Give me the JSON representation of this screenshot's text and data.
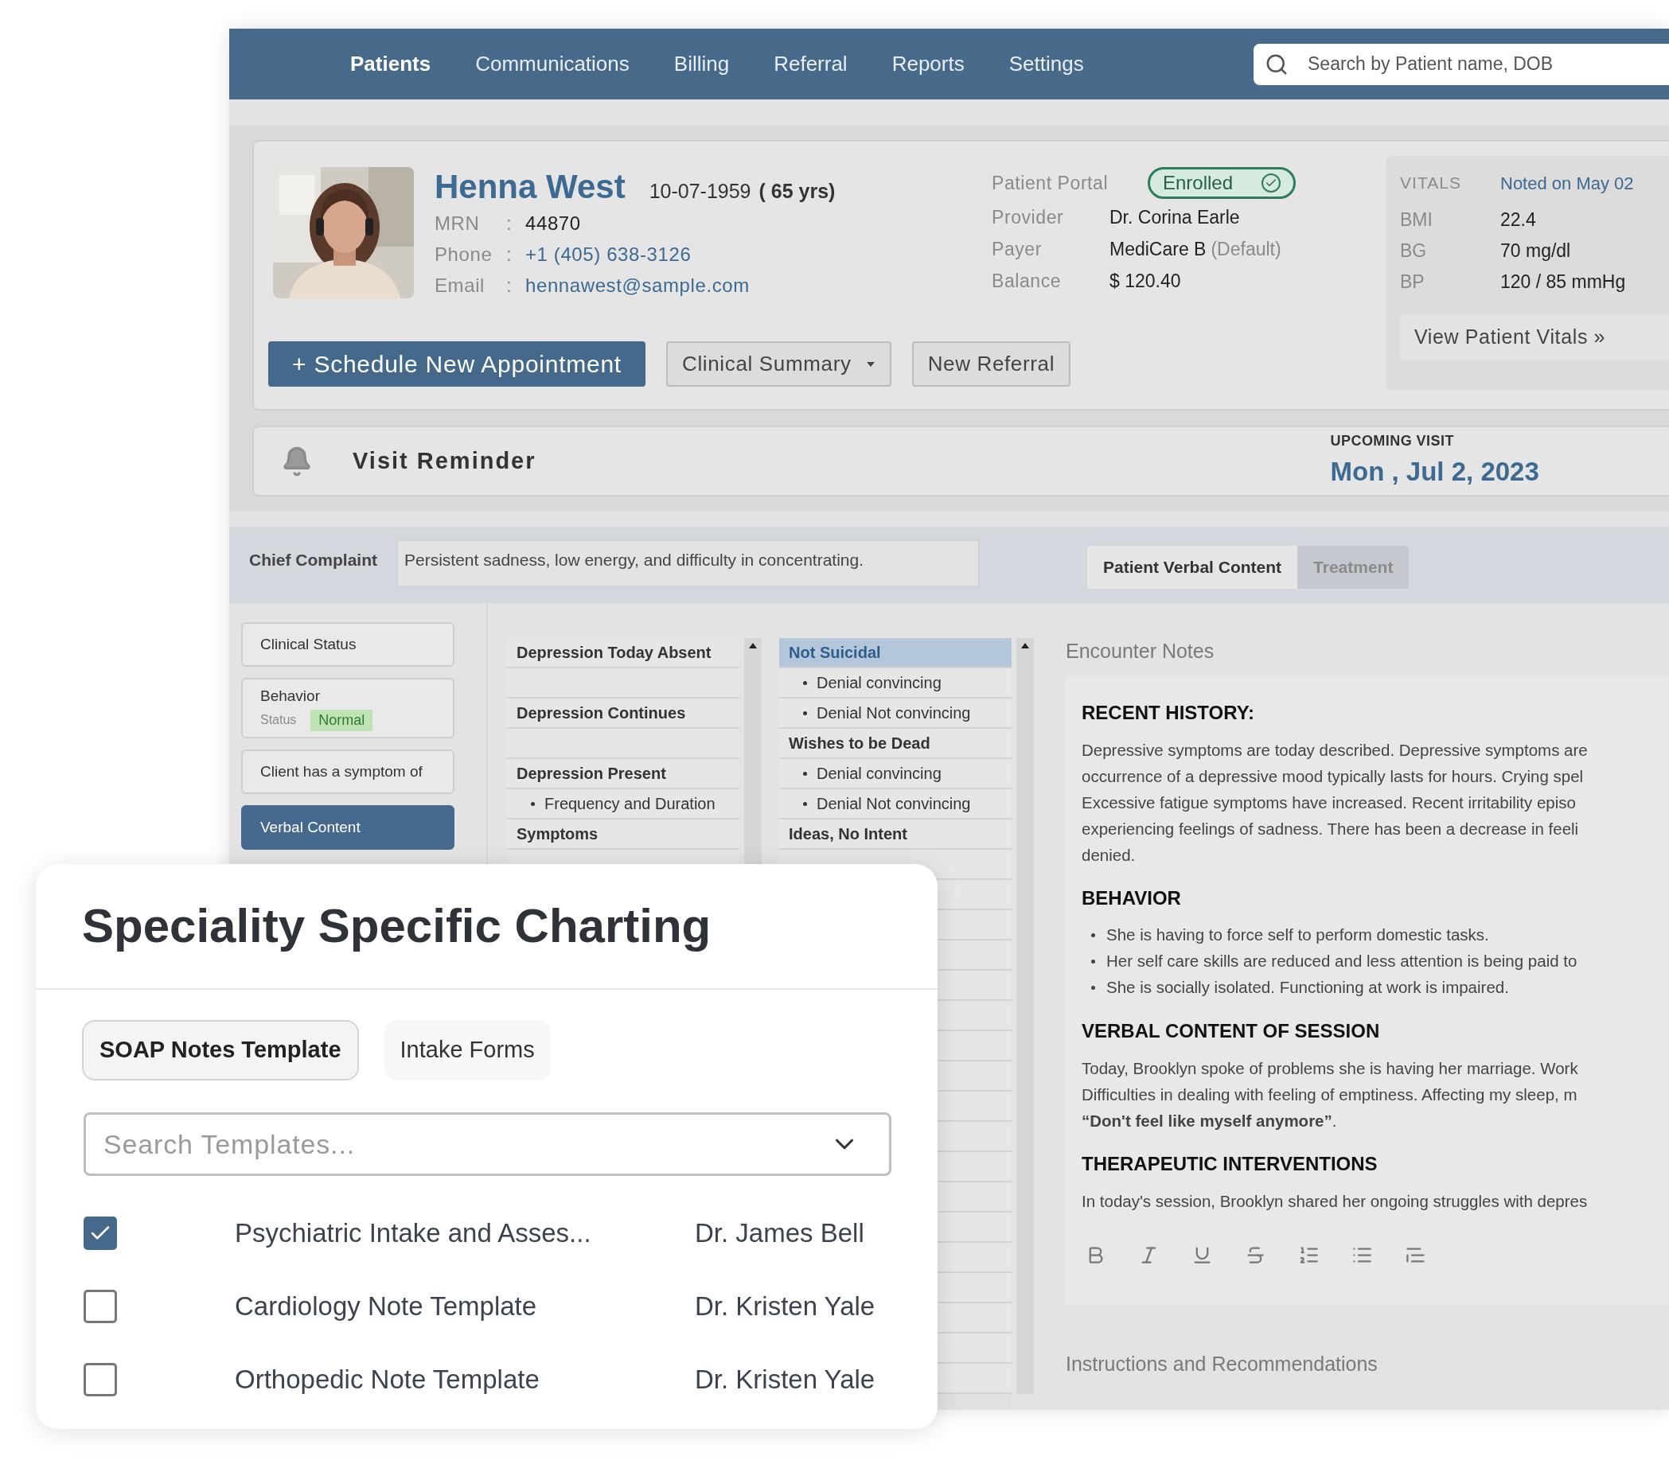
{
  "nav": {
    "items": [
      {
        "label": "Patients",
        "selected": true
      },
      {
        "label": "Communications",
        "selected": false
      },
      {
        "label": "Billing",
        "selected": false
      },
      {
        "label": "Referral",
        "selected": false
      },
      {
        "label": "Reports",
        "selected": false
      },
      {
        "label": "Settings",
        "selected": false
      }
    ],
    "search": {
      "placeholder": "Search by Patient name, DOB"
    }
  },
  "patient": {
    "name": "Henna West",
    "dob": "10-07-1959",
    "age": "( 65 yrs)",
    "fields": [
      {
        "label": "MRN",
        "sep": ":",
        "value": "44870",
        "kind": "plain"
      },
      {
        "label": "Phone",
        "sep": ":",
        "value": "+1 (405) 638-3126",
        "kind": "link"
      },
      {
        "label": "Email",
        "sep": ":",
        "value": "hennawest@sample.com",
        "kind": "link"
      }
    ],
    "portal": {
      "label": "Patient Portal",
      "status": "Enrolled"
    },
    "details": [
      {
        "label": "Provider",
        "value": "Dr. Corina Earle"
      },
      {
        "label": "Payer",
        "value": "MediCare B",
        "note": "(Default)"
      },
      {
        "label": "Balance",
        "value": "$ 120.40"
      }
    ],
    "buttons": [
      {
        "label": "Schedule New Appointment",
        "kind": "primary",
        "icon": "+"
      },
      {
        "label": "Clinical Summary",
        "kind": "dropdown"
      },
      {
        "label": "New Referral",
        "kind": "secondary"
      }
    ],
    "vitals": {
      "title": "VITALS",
      "noted": "Noted on May 02",
      "rows": [
        {
          "label": "BMI",
          "value": "22.4"
        },
        {
          "label": "BG",
          "value": "70 mg/dl"
        },
        {
          "label": "BP",
          "value": "120 / 85 mmHg"
        }
      ],
      "link": "View Patient Vitals",
      "link_icon": "»"
    }
  },
  "reminder": {
    "title": "Visit Reminder",
    "upcoming_label": "UPCOMING VISIT",
    "date": "Mon , Jul 2, 2023"
  },
  "chief_complaint": {
    "label": "Chief Complaint",
    "value": "Persistent sadness, low energy, and difficulty in concentrating."
  },
  "content_tabs": [
    {
      "label": "Patient Verbal Content",
      "selected": true
    },
    {
      "label": "Treatment",
      "selected": false
    }
  ],
  "menu": [
    {
      "label": "Clinical Status",
      "kind": "plain",
      "selected": false
    },
    {
      "label": "Behavior",
      "kind": "status",
      "status_label": "Status",
      "status": "Normal",
      "selected": false
    },
    {
      "label": "Client has a symptom of",
      "kind": "plain",
      "selected": false
    },
    {
      "label": "Verbal Content",
      "kind": "plain",
      "selected": true
    }
  ],
  "lists": [
    {
      "rows": [
        {
          "kind": "heading",
          "text": "Depression Today Absent",
          "selected": false
        },
        {
          "kind": "spacer",
          "selected": false
        },
        {
          "kind": "heading",
          "text": "Depression Continues",
          "selected": false
        },
        {
          "kind": "spacer",
          "selected": false
        },
        {
          "kind": "heading",
          "text": "Depression Present",
          "selected": false
        },
        {
          "kind": "item",
          "text": "Frequency and Duration",
          "selected": false
        },
        {
          "kind": "heading",
          "text": "Symptoms",
          "selected": false
        }
      ]
    },
    {
      "rows": [
        {
          "kind": "heading",
          "text": "Not Suicidal",
          "selected": true
        },
        {
          "kind": "item",
          "text": "Denial convincing",
          "selected": false
        },
        {
          "kind": "item",
          "text": "Denial Not convincing",
          "selected": false
        },
        {
          "kind": "heading",
          "text": "Wishes to be Dead",
          "selected": false
        },
        {
          "kind": "item",
          "text": "Denial convincing",
          "selected": false
        },
        {
          "kind": "item",
          "text": "Denial Not convincing",
          "selected": false
        },
        {
          "kind": "heading",
          "text": "Ideas, No Intent",
          "selected": false
        }
      ]
    }
  ],
  "notes": {
    "title": "Encounter Notes",
    "sections": [
      {
        "heading": "RECENT HISTORY:",
        "kind": "lines",
        "lines": [
          "Depressive symptoms are today described. Depressive symptoms are",
          "occurrence of a depressive mood typically lasts for hours. Crying spel",
          "Excessive  fatigue symptoms have increased. Recent irritability episo",
          "experiencing  feelings of sadness. There has been a decrease in feeli",
          "denied."
        ]
      },
      {
        "heading": "BEHAVIOR",
        "kind": "bullets",
        "lines": [
          "She is having to force self to perform domestic tasks.",
          "Her self care skills are reduced and less attention is being paid to",
          "She is socially isolated. Functioning at work is impaired."
        ]
      },
      {
        "heading": "VERBAL CONTENT OF SESSION",
        "kind": "lines",
        "lines": [
          "Today, Brooklyn spoke of problems she is having her marriage. Work",
          "Difficulties in dealing with feeling of emptiness. Affecting my sleep, m",
          "**“Don't feel like myself anymore”**."
        ]
      },
      {
        "heading": "THERAPEUTIC INTERVENTIONS",
        "kind": "lines",
        "lines": [
          "In today's session, Brooklyn shared her ongoing struggles with depres"
        ]
      }
    ],
    "next_section": "Instructions and Recommendations"
  },
  "charting": {
    "title": "Speciality Specific Charting",
    "tabs": [
      {
        "label": "SOAP Notes Template",
        "selected": true
      },
      {
        "label": "Intake Forms",
        "selected": false
      }
    ],
    "search": {
      "placeholder": "Search Templates..."
    },
    "templates": [
      {
        "name": "Psychiatric Intake and Asses...",
        "author": "Dr. James Bell",
        "checked": true
      },
      {
        "name": "Cardiology Note Template",
        "author": "Dr. Kristen Yale",
        "checked": false
      },
      {
        "name": "Orthopedic Note Template",
        "author": "Dr. Kristen Yale",
        "checked": false
      }
    ]
  }
}
